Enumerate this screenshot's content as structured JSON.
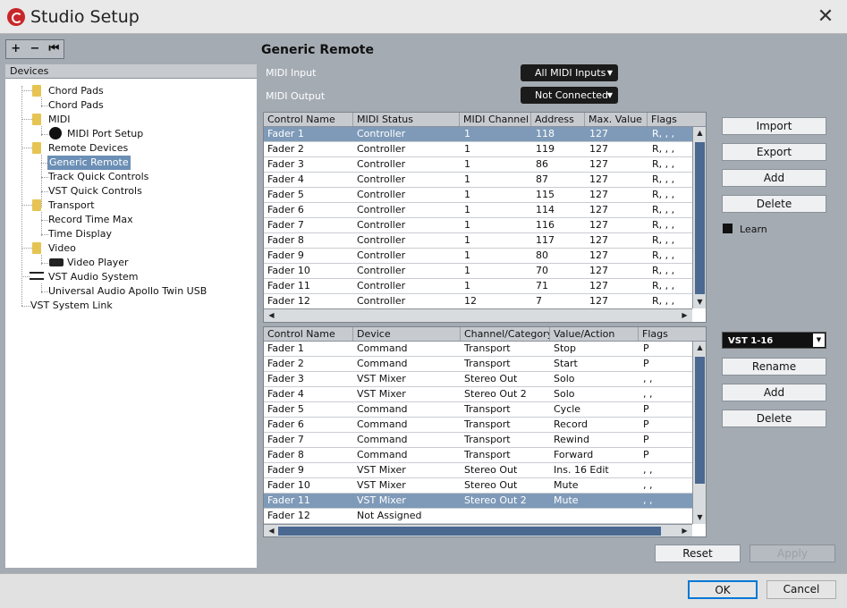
{
  "window": {
    "title": "Studio Setup",
    "close_glyph": "✕"
  },
  "toolbar": {
    "add": "+",
    "remove": "−",
    "reset": "⏮"
  },
  "left": {
    "header": "Devices"
  },
  "tree": {
    "chord_pads_folder": "Chord Pads",
    "chord_pads": "Chord Pads",
    "midi_folder": "MIDI",
    "midi_port_setup": "MIDI Port Setup",
    "remote_devices_folder": "Remote Devices",
    "generic_remote": "Generic Remote",
    "track_quick_controls": "Track Quick Controls",
    "vst_quick_controls": "VST Quick Controls",
    "transport_folder": "Transport",
    "record_time_max": "Record Time Max",
    "time_display": "Time Display",
    "video_folder": "Video",
    "video_player": "Video Player",
    "vst_audio_system": "VST Audio System",
    "apollo": "Universal Audio Apollo Twin USB",
    "vst_system_link": "VST System Link"
  },
  "main": {
    "heading": "Generic Remote",
    "midi_input_label": "MIDI Input",
    "midi_input_value": "All MIDI Inputs",
    "midi_output_label": "MIDI Output",
    "midi_output_value": "Not Connected"
  },
  "table1": {
    "headers": [
      "Control Name",
      "MIDI Status",
      "MIDI Channel",
      "Address",
      "Max. Value",
      "Flags"
    ],
    "rows": [
      [
        "Fader 1",
        "Controller",
        "1",
        "118",
        "127",
        "R, , ,"
      ],
      [
        "Fader 2",
        "Controller",
        "1",
        "119",
        "127",
        "R, , ,"
      ],
      [
        "Fader 3",
        "Controller",
        "1",
        "86",
        "127",
        "R, , ,"
      ],
      [
        "Fader 4",
        "Controller",
        "1",
        "87",
        "127",
        "R, , ,"
      ],
      [
        "Fader 5",
        "Controller",
        "1",
        "115",
        "127",
        "R, , ,"
      ],
      [
        "Fader 6",
        "Controller",
        "1",
        "114",
        "127",
        "R, , ,"
      ],
      [
        "Fader 7",
        "Controller",
        "1",
        "116",
        "127",
        "R, , ,"
      ],
      [
        "Fader 8",
        "Controller",
        "1",
        "117",
        "127",
        "R, , ,"
      ],
      [
        "Fader 9",
        "Controller",
        "1",
        "80",
        "127",
        "R, , ,"
      ],
      [
        "Fader 10",
        "Controller",
        "1",
        "70",
        "127",
        "R, , ,"
      ],
      [
        "Fader 11",
        "Controller",
        "1",
        "71",
        "127",
        "R, , ,"
      ],
      [
        "Fader 12",
        "Controller",
        "12",
        "7",
        "127",
        "R, , ,"
      ]
    ]
  },
  "table2": {
    "headers": [
      "Control Name",
      "Device",
      "Channel/Category",
      "Value/Action",
      "Flags"
    ],
    "rows": [
      [
        "Fader 1",
        "Command",
        "Transport",
        "Stop",
        "P"
      ],
      [
        "Fader 2",
        "Command",
        "Transport",
        "Start",
        "P"
      ],
      [
        "Fader 3",
        "VST Mixer",
        "Stereo Out",
        "Solo",
        ", ,"
      ],
      [
        "Fader 4",
        "VST Mixer",
        "Stereo Out 2",
        "Solo",
        ", ,"
      ],
      [
        "Fader 5",
        "Command",
        "Transport",
        "Cycle",
        "P"
      ],
      [
        "Fader 6",
        "Command",
        "Transport",
        "Record",
        "P"
      ],
      [
        "Fader 7",
        "Command",
        "Transport",
        "Rewind",
        "P"
      ],
      [
        "Fader 8",
        "Command",
        "Transport",
        "Forward",
        "P"
      ],
      [
        "Fader 9",
        "VST Mixer",
        "Stereo Out",
        "Ins. 16 Edit",
        ", ,"
      ],
      [
        "Fader 10",
        "VST Mixer",
        "Stereo Out",
        "Mute",
        ", ,"
      ],
      [
        "Fader 11",
        "VST Mixer",
        "Stereo Out 2",
        "Mute",
        ", ,"
      ],
      [
        "Fader 12",
        "Not Assigned",
        "",
        "",
        ""
      ]
    ]
  },
  "buttons": {
    "import": "Import",
    "export": "Export",
    "add": "Add",
    "delete": "Delete",
    "learn": "Learn",
    "bank": "VST 1-16",
    "rename": "Rename",
    "add2": "Add",
    "delete2": "Delete",
    "reset": "Reset",
    "apply": "Apply",
    "ok": "OK",
    "cancel": "Cancel"
  },
  "glyphs": {
    "up": "▲",
    "down": "▼",
    "left": "◀",
    "right": "▶"
  }
}
